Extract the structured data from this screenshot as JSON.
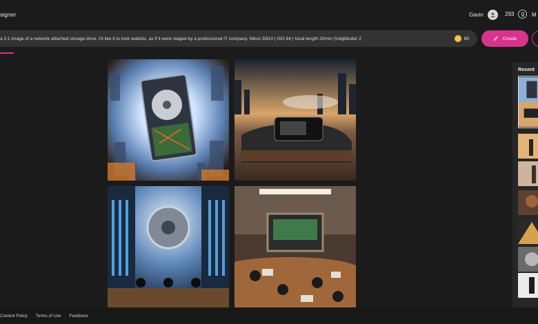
{
  "header": {
    "brand": "signer",
    "user_name": "Gavin",
    "points": "293",
    "menu_initial": "M"
  },
  "prompt": {
    "text": "a 2:1 image of a network attached storage drive. I'd like it to look realistic, as if it were staged by a professional IT company.  Nikon D810 | ISO 64 | focal length 20mm (Voigtländer 2",
    "boosts": "90",
    "create_label": "Create"
  },
  "recent": {
    "title": "Recent"
  },
  "footer": {
    "links": [
      "Content Policy",
      "Terms of Use",
      "Feedback"
    ]
  },
  "colors": {
    "accent": "#d6348d",
    "background": "#1b1b1b",
    "coin": "#f4c34a"
  },
  "icons": [
    "user-icon",
    "trophy-icon",
    "coin-icon",
    "create-icon"
  ]
}
